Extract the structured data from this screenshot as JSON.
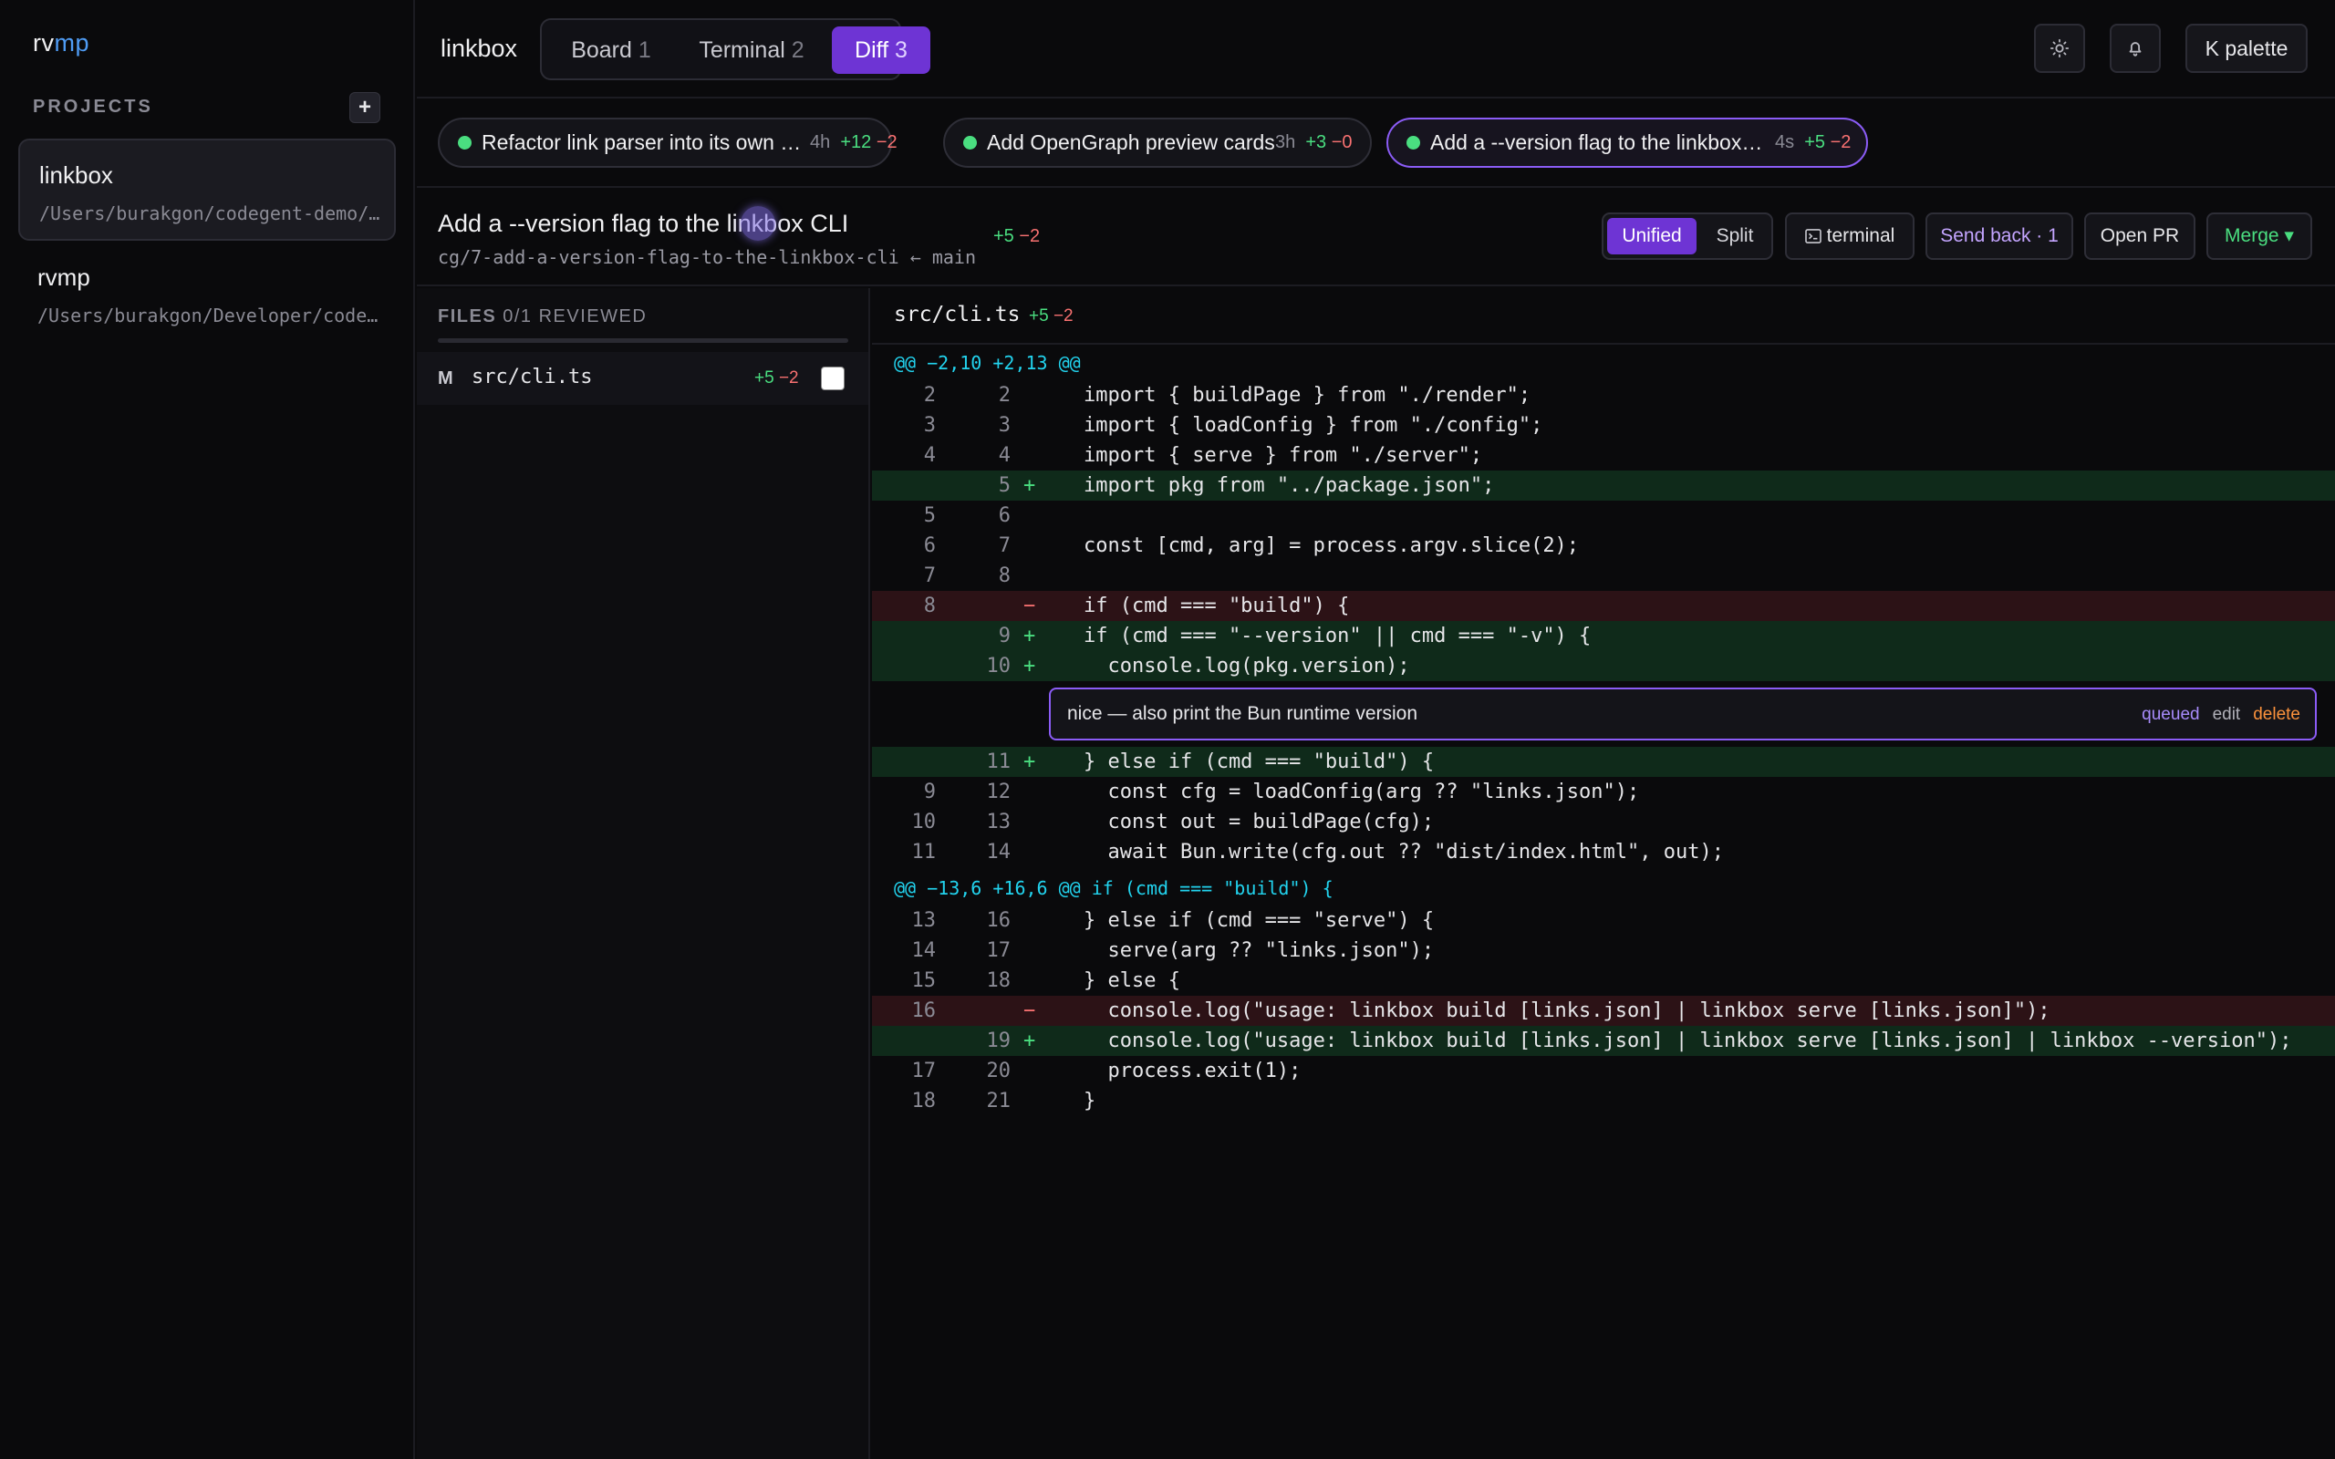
{
  "sidebar": {
    "logo_a": "rv",
    "logo_b": "mp",
    "projects_heading": "PROJECTS",
    "add_label": "+",
    "projects": [
      {
        "name": "linkbox",
        "path": "/Users/burakgon/codegent-demo/linkbox"
      },
      {
        "name": "rvmp",
        "path": "/Users/burakgon/Developer/codegent"
      }
    ]
  },
  "header": {
    "title": "linkbox",
    "tabs": [
      {
        "label": "Board",
        "count": "1"
      },
      {
        "label": "Terminal",
        "count": "2"
      },
      {
        "label": "Diff",
        "count": "3"
      }
    ],
    "palette_label": "K palette"
  },
  "tasks": [
    {
      "title": "Refactor link parser into its own m…",
      "age": "4h",
      "add": "+12",
      "del": "−2"
    },
    {
      "title": "Add OpenGraph preview cards",
      "age": "3h",
      "add": "+3",
      "del": "−0"
    },
    {
      "title": "Add a --version flag to the linkbox …",
      "age": "4s",
      "add": "+5",
      "del": "−2"
    }
  ],
  "info": {
    "title": "Add a --version flag to the linkbox CLI",
    "branch": "cg/7-add-a-version-flag-to-the-linkbox-cli ← main",
    "add": "+5",
    "del": "−2",
    "unified": "Unified",
    "split": "Split",
    "terminal": "terminal",
    "send_back": "Send back · 1",
    "open_pr": "Open PR",
    "merge": "Merge ▾"
  },
  "files": {
    "heading": "FILES",
    "reviewed": "0/1 REVIEWED",
    "items": [
      {
        "status": "M",
        "name": "src/cli.ts",
        "add": "+5",
        "del": "−2"
      }
    ]
  },
  "diff": {
    "file": "src/cli.ts",
    "add": "+5",
    "del": "−2",
    "hunks": [
      "@@ −2,10 +2,13 @@",
      "@@ −13,6 +16,6 @@ if (cmd === \"build\") {"
    ],
    "lines": [
      {
        "o": "2",
        "n": "2",
        "s": "",
        "t": "ctx",
        "code": "import { buildPage } from \"./render\";"
      },
      {
        "o": "3",
        "n": "3",
        "s": "",
        "t": "ctx",
        "code": "import { loadConfig } from \"./config\";"
      },
      {
        "o": "4",
        "n": "4",
        "s": "",
        "t": "ctx",
        "code": "import { serve } from \"./server\";"
      },
      {
        "o": "",
        "n": "5",
        "s": "+",
        "t": "add",
        "code": "import pkg from \"../package.json\";"
      },
      {
        "o": "5",
        "n": "6",
        "s": "",
        "t": "ctx",
        "code": ""
      },
      {
        "o": "6",
        "n": "7",
        "s": "",
        "t": "ctx",
        "code": "const [cmd, arg] = process.argv.slice(2);"
      },
      {
        "o": "7",
        "n": "8",
        "s": "",
        "t": "ctx",
        "code": ""
      },
      {
        "o": "8",
        "n": "",
        "s": "−",
        "t": "del",
        "code": "if (cmd === \"build\") {"
      },
      {
        "o": "",
        "n": "9",
        "s": "+",
        "t": "add",
        "code": "if (cmd === \"--version\" || cmd === \"-v\") {"
      },
      {
        "o": "",
        "n": "10",
        "s": "+",
        "t": "add",
        "code": "  console.log(pkg.version);"
      },
      {
        "o": "",
        "n": "11",
        "s": "+",
        "t": "add",
        "code": "} else if (cmd === \"build\") {"
      },
      {
        "o": "9",
        "n": "12",
        "s": "",
        "t": "ctx",
        "code": "  const cfg = loadConfig(arg ?? \"links.json\");"
      },
      {
        "o": "10",
        "n": "13",
        "s": "",
        "t": "ctx",
        "code": "  const out = buildPage(cfg);"
      },
      {
        "o": "11",
        "n": "14",
        "s": "",
        "t": "ctx",
        "code": "  await Bun.write(cfg.out ?? \"dist/index.html\", out);"
      },
      {
        "o": "13",
        "n": "16",
        "s": "",
        "t": "ctx",
        "code": "} else if (cmd === \"serve\") {"
      },
      {
        "o": "14",
        "n": "17",
        "s": "",
        "t": "ctx",
        "code": "  serve(arg ?? \"links.json\");"
      },
      {
        "o": "15",
        "n": "18",
        "s": "",
        "t": "ctx",
        "code": "} else {"
      },
      {
        "o": "16",
        "n": "",
        "s": "−",
        "t": "del",
        "code": "  console.log(\"usage: linkbox build [links.json] | linkbox serve [links.json]\");"
      },
      {
        "o": "",
        "n": "19",
        "s": "+",
        "t": "add",
        "code": "  console.log(\"usage: linkbox build [links.json] | linkbox serve [links.json] | linkbox --version\");"
      },
      {
        "o": "17",
        "n": "20",
        "s": "",
        "t": "ctx",
        "code": "  process.exit(1);"
      },
      {
        "o": "18",
        "n": "21",
        "s": "",
        "t": "ctx",
        "code": "}"
      }
    ],
    "comment": {
      "text": "nice — also print the Bun runtime version",
      "queued": "queued",
      "edit": "edit",
      "delete": "delete"
    }
  },
  "icons": {
    "theme": "sun-icon",
    "notifications": "bell-icon",
    "terminal": "terminal-icon"
  },
  "colors": {
    "accent": "#6e34d4",
    "add": "#4ade80",
    "del": "#f87171",
    "hunk": "#22d3ee"
  }
}
